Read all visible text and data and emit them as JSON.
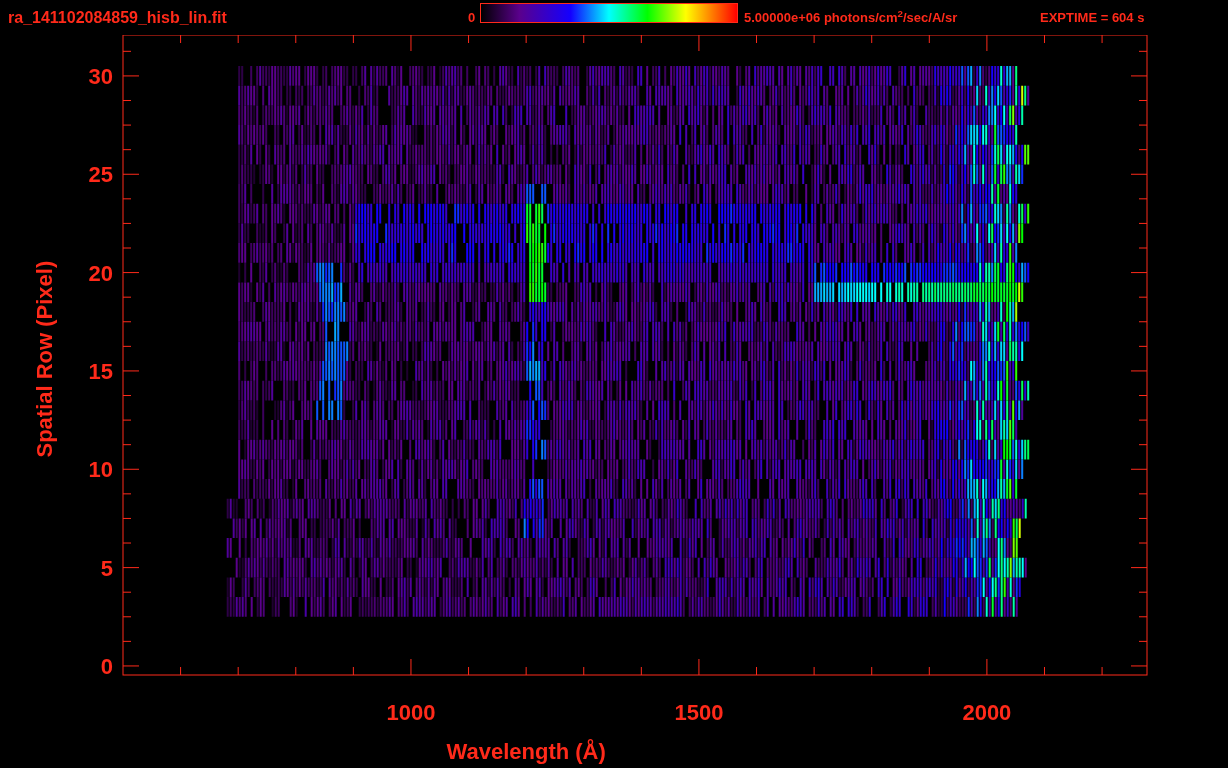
{
  "header": {
    "title": "ra_141102084859_hisb_lin.fit",
    "colorbar_min": "0",
    "colorbar_max": "5.00000e+06 photons/cm$^{2}$/sec/A/sr",
    "exposure": "EXPTIME = 604 s"
  },
  "plot": {
    "xlabel": "Wavelength (Å)",
    "ylabel": "Spatial Row (Pixel)",
    "xtick_labels": [
      "1000",
      "1500",
      "2000"
    ],
    "ytick_labels": [
      "30",
      "25",
      "20",
      "15",
      "10",
      "5",
      "0"
    ]
  }
}
